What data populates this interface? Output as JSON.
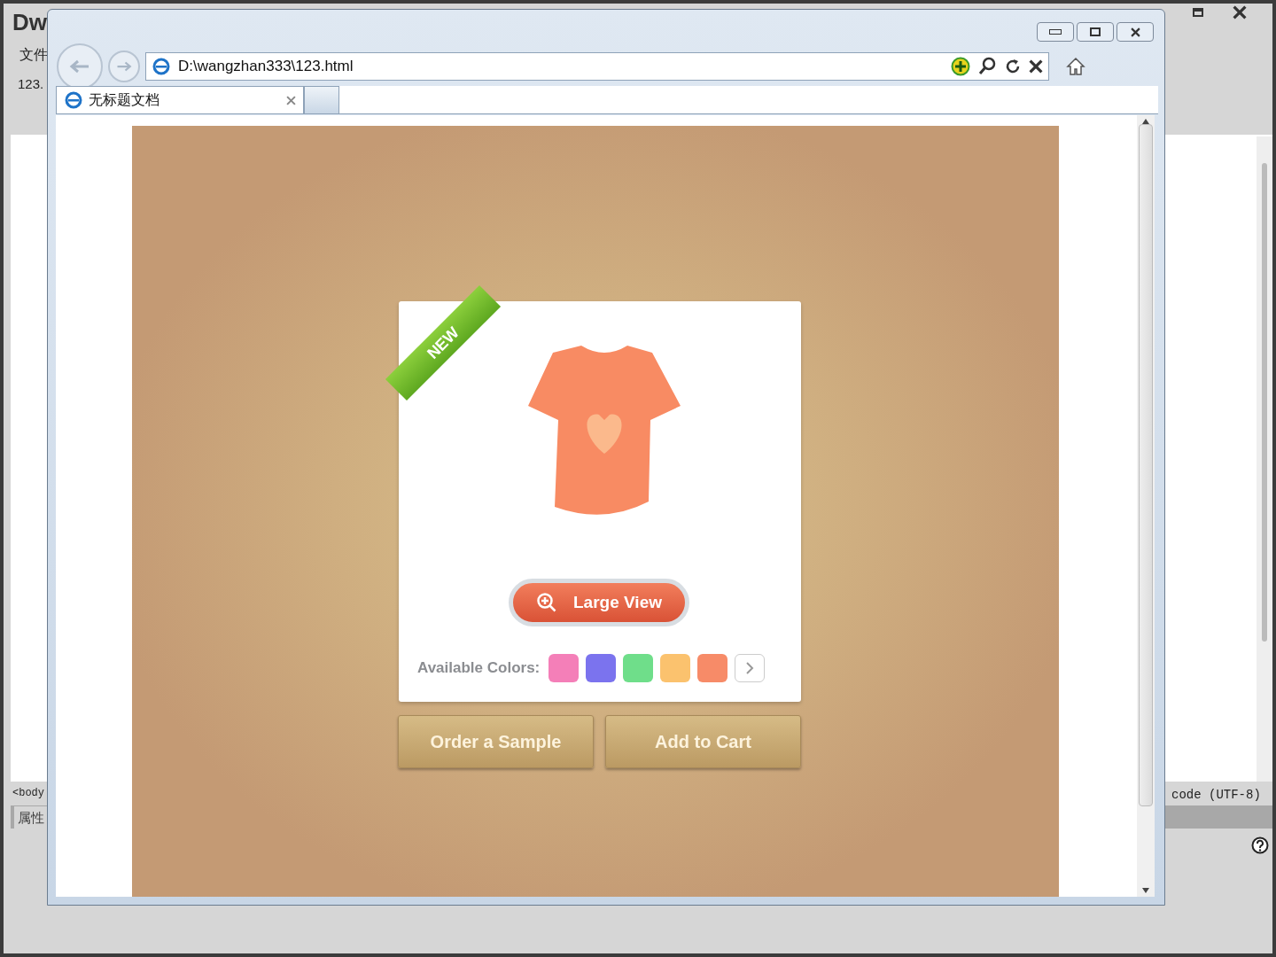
{
  "background_app": {
    "logo": "Dw",
    "menu_item": "文件",
    "doc_tab": "123.",
    "tag_selector": "<body",
    "panel_title": "属性",
    "encoding": "code (UTF-8)"
  },
  "browser": {
    "address": "D:\\wangzhan333\\123.html",
    "tabs": [
      {
        "label": "无标题文档",
        "selected": true
      }
    ],
    "page": {
      "ribbon": "NEW",
      "large_view": "Large View",
      "colors_label": "Available Colors:",
      "swatches": [
        {
          "color": "#f47fb8"
        },
        {
          "color": "#7b73ee"
        },
        {
          "color": "#6fde8a"
        },
        {
          "color": "#fbc26e"
        },
        {
          "color": "#f78b68"
        }
      ],
      "buttons": [
        "Order a Sample",
        "Add to Cart"
      ]
    }
  }
}
